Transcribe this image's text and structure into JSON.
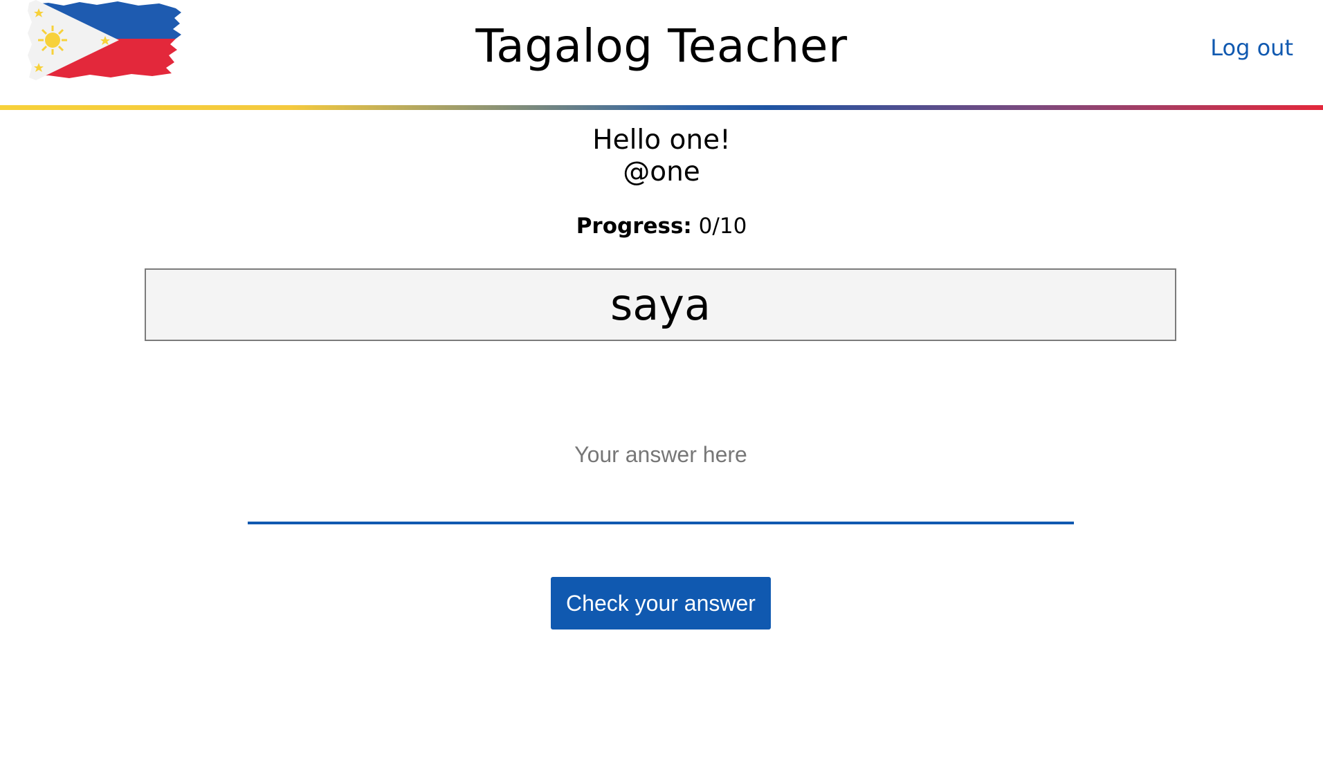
{
  "header": {
    "title": "Tagalog Teacher",
    "logout_label": "Log out",
    "logo_icon": "philippine-flag-icon"
  },
  "greeting": {
    "hello": "Hello one!",
    "handle": "@one"
  },
  "progress": {
    "label": "Progress:",
    "value": "0/10"
  },
  "quiz": {
    "word": "saya",
    "answer_placeholder": "Your answer here",
    "answer_value": "",
    "check_label": "Check your answer"
  },
  "colors": {
    "accent": "#1059b0",
    "flag_blue": "#1e5bb0",
    "flag_red": "#e3283b",
    "flag_yellow": "#f7d13a",
    "card_background": "#f4f4f4"
  }
}
